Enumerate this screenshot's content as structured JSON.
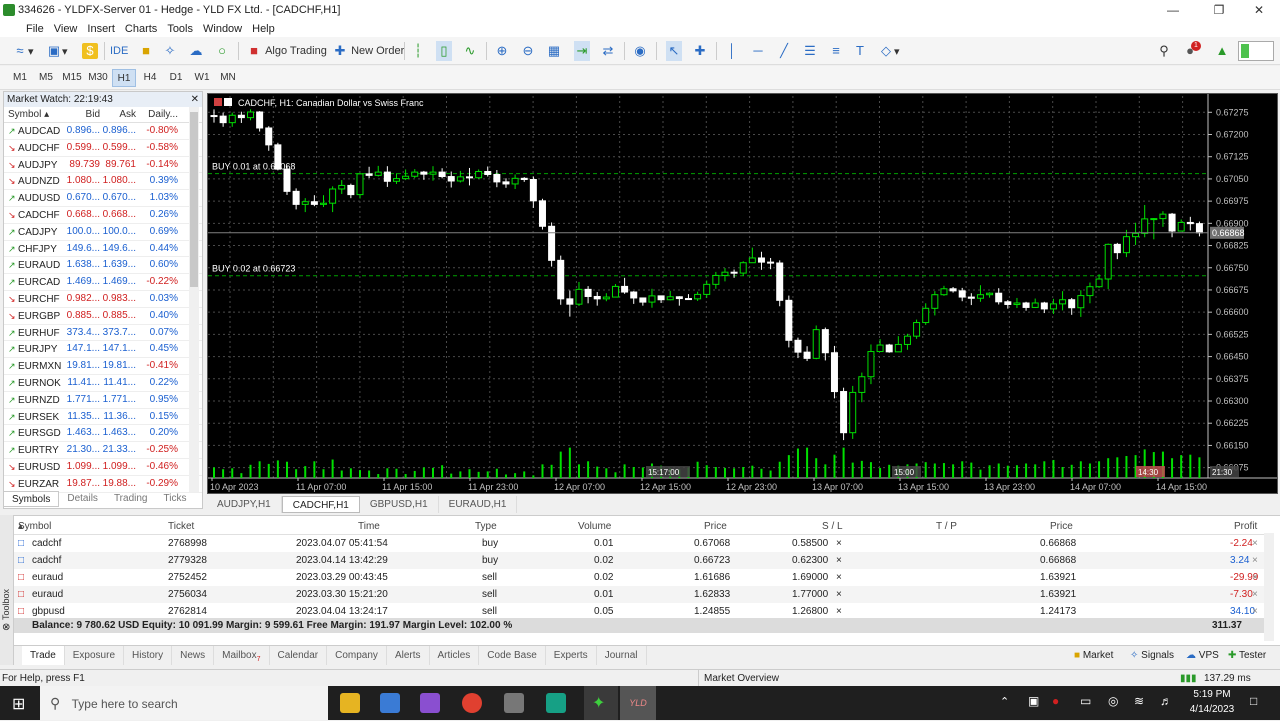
{
  "window": {
    "title": "334626 - YLDFX-Server 01 - Hedge - YLD FX Ltd. - [CADCHF,H1]"
  },
  "menu": [
    "File",
    "View",
    "Insert",
    "Charts",
    "Tools",
    "Window",
    "Help"
  ],
  "toolbar": {
    "ide": "IDE",
    "algo": "Algo Trading",
    "new_order": "New Order"
  },
  "timeframes": [
    {
      "label": "M1"
    },
    {
      "label": "M5"
    },
    {
      "label": "M15"
    },
    {
      "label": "M30"
    },
    {
      "label": "H1",
      "active": true
    },
    {
      "label": "H4"
    },
    {
      "label": "D1"
    },
    {
      "label": "W1"
    },
    {
      "label": "MN"
    }
  ],
  "market_watch": {
    "title": "Market Watch: 22:19:43",
    "columns": [
      "Symbol",
      "Bid",
      "Ask",
      "Daily..."
    ],
    "rows": [
      {
        "symbol": "AUDCAD",
        "bid": "0.896...",
        "ask": "0.896...",
        "chg": "-0.80%",
        "dir": "up"
      },
      {
        "symbol": "AUDCHF",
        "bid": "0.599...",
        "ask": "0.599...",
        "chg": "-0.58%",
        "dir": "dn"
      },
      {
        "symbol": "AUDJPY",
        "bid": "89.739",
        "ask": "89.761",
        "chg": "-0.14%",
        "dir": "dn"
      },
      {
        "symbol": "AUDNZD",
        "bid": "1.080...",
        "ask": "1.080...",
        "chg": "0.39%",
        "dir": "dn"
      },
      {
        "symbol": "AUDUSD",
        "bid": "0.670...",
        "ask": "0.670...",
        "chg": "1.03%",
        "dir": "up"
      },
      {
        "symbol": "CADCHF",
        "bid": "0.668...",
        "ask": "0.668...",
        "chg": "0.26%",
        "dir": "dn"
      },
      {
        "symbol": "CADJPY",
        "bid": "100.0...",
        "ask": "100.0...",
        "chg": "0.69%",
        "dir": "up"
      },
      {
        "symbol": "CHFJPY",
        "bid": "149.6...",
        "ask": "149.6...",
        "chg": "0.44%",
        "dir": "up"
      },
      {
        "symbol": "EURAUD",
        "bid": "1.638...",
        "ask": "1.639...",
        "chg": "0.60%",
        "dir": "up"
      },
      {
        "symbol": "EURCAD",
        "bid": "1.469...",
        "ask": "1.469...",
        "chg": "-0.22%",
        "dir": "up"
      },
      {
        "symbol": "EURCHF",
        "bid": "0.982...",
        "ask": "0.983...",
        "chg": "0.03%",
        "dir": "dn"
      },
      {
        "symbol": "EURGBP",
        "bid": "0.885...",
        "ask": "0.885...",
        "chg": "0.40%",
        "dir": "dn"
      },
      {
        "symbol": "EURHUF",
        "bid": "373.4...",
        "ask": "373.7...",
        "chg": "0.07%",
        "dir": "up"
      },
      {
        "symbol": "EURJPY",
        "bid": "147.1...",
        "ask": "147.1...",
        "chg": "0.45%",
        "dir": "up"
      },
      {
        "symbol": "EURMXN",
        "bid": "19.81...",
        "ask": "19.81...",
        "chg": "-0.41%",
        "dir": "up"
      },
      {
        "symbol": "EURNOK",
        "bid": "11.41...",
        "ask": "11.41...",
        "chg": "0.22%",
        "dir": "up"
      },
      {
        "symbol": "EURNZD",
        "bid": "1.771...",
        "ask": "1.771...",
        "chg": "0.95%",
        "dir": "up"
      },
      {
        "symbol": "EURSEK",
        "bid": "11.35...",
        "ask": "11.36...",
        "chg": "0.15%",
        "dir": "up"
      },
      {
        "symbol": "EURSGD",
        "bid": "1.463...",
        "ask": "1.463...",
        "chg": "0.20%",
        "dir": "up"
      },
      {
        "symbol": "EURTRY",
        "bid": "21.30...",
        "ask": "21.33...",
        "chg": "-0.25%",
        "dir": "up"
      },
      {
        "symbol": "EURUSD",
        "bid": "1.099...",
        "ask": "1.099...",
        "chg": "-0.46%",
        "dir": "dn"
      },
      {
        "symbol": "EURZAR",
        "bid": "19.87...",
        "ask": "19.88...",
        "chg": "-0.29%",
        "dir": "dn"
      }
    ],
    "tabs": [
      "Symbols",
      "Details",
      "Trading",
      "Ticks"
    ]
  },
  "chart": {
    "header": "CADCHF, H1:  Canadian Dollar vs Swiss Franc",
    "price_labels": [
      "0.67275",
      "0.67200",
      "0.67125",
      "0.67050",
      "0.66975",
      "0.66900",
      "0.66825",
      "0.66750",
      "0.66675",
      "0.66600",
      "0.66525",
      "0.66450",
      "0.66375",
      "0.66300",
      "0.66225",
      "0.66150",
      "0.66075"
    ],
    "current_price": "0.66868",
    "time_labels": [
      "10 Apr 2023",
      "11 Apr 07:00",
      "11 Apr 15:00",
      "11 Apr 23:00",
      "12 Apr 07:00",
      "12 Apr 15:00",
      "12 Apr 23:00",
      "13 Apr 07:00",
      "13 Apr 15:00",
      "13 Apr 23:00",
      "14 Apr 07:00",
      "14 Apr 15:00"
    ],
    "markers": [
      "15:17:00",
      "15:00",
      "14:30",
      "21:30"
    ],
    "orders": [
      {
        "label": "BUY 0.01 at 0.67068",
        "price": 0.67068
      },
      {
        "label": "BUY 0.02 at 0.66723",
        "price": 0.66723
      }
    ],
    "tabs": [
      "AUDJPY,H1",
      "CADCHF,H1",
      "GBPUSD,H1",
      "EURAUD,H1"
    ],
    "active_tab": "CADCHF,H1"
  },
  "trade": {
    "columns": [
      "Symbol",
      "Ticket",
      "Time",
      "Type",
      "Volume",
      "Price",
      "S / L",
      "T / P",
      "Price",
      "Profit"
    ],
    "rows": [
      {
        "symbol": "cadchf",
        "ticket": "2768998",
        "time": "2023.04.07 05:41:54",
        "type": "buy",
        "volume": "0.01",
        "price": "0.67068",
        "sl": "0.58500",
        "cur": "0.66868",
        "profit": "-2.24",
        "neg": true
      },
      {
        "symbol": "cadchf",
        "ticket": "2779328",
        "time": "2023.04.14 13:42:29",
        "type": "buy",
        "volume": "0.02",
        "price": "0.66723",
        "sl": "0.62300",
        "cur": "0.66868",
        "profit": "3.24",
        "neg": false
      },
      {
        "symbol": "euraud",
        "ticket": "2752452",
        "time": "2023.03.29 00:43:45",
        "type": "sell",
        "volume": "0.02",
        "price": "1.61686",
        "sl": "1.69000",
        "cur": "1.63921",
        "profit": "-29.99",
        "neg": true
      },
      {
        "symbol": "euraud",
        "ticket": "2756034",
        "time": "2023.03.30 15:21:20",
        "type": "sell",
        "volume": "0.01",
        "price": "1.62833",
        "sl": "1.77000",
        "cur": "1.63921",
        "profit": "-7.30",
        "neg": true
      },
      {
        "symbol": "gbpusd",
        "ticket": "2762814",
        "time": "2023.04.04 13:24:17",
        "type": "sell",
        "volume": "0.05",
        "price": "1.24855",
        "sl": "1.26800",
        "cur": "1.24173",
        "profit": "34.10",
        "neg": false
      }
    ],
    "balance_line": "Balance: 9 780.62 USD  Equity: 10 091.99  Margin: 9 599.61  Free Margin: 191.97  Margin Level: 102.00 %",
    "total_profit": "311.37",
    "tabs": [
      "Trade",
      "Exposure",
      "History",
      "News",
      "Mailbox",
      "Calendar",
      "Company",
      "Alerts",
      "Articles",
      "Code Base",
      "Experts",
      "Journal"
    ],
    "mailbox_count": "7",
    "side_label": "Toolbox",
    "right_links": [
      "Market",
      "Signals",
      "VPS",
      "Tester"
    ]
  },
  "status": {
    "help": "For Help, press F1",
    "overview": "Market Overview",
    "ping": "137.29 ms"
  },
  "taskbar": {
    "search": "Type here to search",
    "time": "5:19 PM",
    "date": "4/14/2023",
    "app_label": "YLD"
  },
  "colors": {
    "bull": "#00e000",
    "bear": "#ffffff",
    "order_line": "#00a000",
    "grid": "#4a4a4a",
    "axis": "#c0c0c0"
  },
  "chart_data": {
    "type": "candlestick",
    "symbol": "CADCHF",
    "timeframe": "H1",
    "ylim": [
      0.6604,
      0.6733
    ],
    "candles": [
      [
        0.67264,
        0.67262,
        0.67285,
        0.6724
      ],
      [
        0.67262,
        0.6724,
        0.67274,
        0.67226
      ],
      [
        0.6724,
        0.67265,
        0.67274,
        0.67226
      ],
      [
        0.67265,
        0.67257,
        0.67277,
        0.67239
      ],
      [
        0.67257,
        0.67276,
        0.67285,
        0.67248
      ],
      [
        0.67276,
        0.67222,
        0.67279,
        0.6721
      ],
      [
        0.67222,
        0.67165,
        0.67228,
        0.67145
      ],
      [
        0.67165,
        0.67083,
        0.67172,
        0.67079
      ],
      [
        0.67083,
        0.67008,
        0.67095,
        0.66996
      ],
      [
        0.67008,
        0.66964,
        0.67018,
        0.66947
      ],
      [
        0.66964,
        0.66973,
        0.66985,
        0.66938
      ],
      [
        0.66973,
        0.66964,
        0.66995,
        0.66958
      ],
      [
        0.66964,
        0.66968,
        0.66995,
        0.66955
      ],
      [
        0.66968,
        0.67016,
        0.67025,
        0.66938
      ],
      [
        0.67016,
        0.67028,
        0.67046,
        0.66999
      ],
      [
        0.67028,
        0.66997,
        0.67034,
        0.66985
      ],
      [
        0.66997,
        0.67067,
        0.6707,
        0.66984
      ],
      [
        0.67067,
        0.67062,
        0.67091,
        0.67053
      ],
      [
        0.67062,
        0.67073,
        0.67094,
        0.67058
      ],
      [
        0.67073,
        0.67042,
        0.67093,
        0.67023
      ],
      [
        0.67042,
        0.67051,
        0.67069,
        0.67033
      ],
      [
        0.67051,
        0.67059,
        0.67082,
        0.67046
      ],
      [
        0.67059,
        0.67073,
        0.67083,
        0.67053
      ],
      [
        0.67073,
        0.67066,
        0.67077,
        0.67047
      ],
      [
        0.67066,
        0.67073,
        0.67093,
        0.67044
      ],
      [
        0.67073,
        0.67058,
        0.67086,
        0.67052
      ],
      [
        0.67058,
        0.67043,
        0.67075,
        0.67021
      ],
      [
        0.67043,
        0.67057,
        0.67077,
        0.67038
      ],
      [
        0.67057,
        0.67054,
        0.67087,
        0.67028
      ],
      [
        0.67054,
        0.67075,
        0.67082,
        0.6705
      ],
      [
        0.67075,
        0.67065,
        0.67092,
        0.67058
      ],
      [
        0.67065,
        0.6704,
        0.6708,
        0.67022
      ],
      [
        0.6704,
        0.67033,
        0.67052,
        0.6702
      ],
      [
        0.67033,
        0.67052,
        0.67065,
        0.67016
      ],
      [
        0.67052,
        0.67048,
        0.67056,
        0.6704
      ],
      [
        0.67048,
        0.66976,
        0.67058,
        0.66952
      ],
      [
        0.66976,
        0.6689,
        0.66983,
        0.66879
      ],
      [
        0.6689,
        0.66775,
        0.66903,
        0.66754
      ],
      [
        0.66775,
        0.66645,
        0.66791,
        0.66625
      ],
      [
        0.66645,
        0.66627,
        0.66673,
        0.66585
      ],
      [
        0.66627,
        0.66677,
        0.66702,
        0.66621
      ],
      [
        0.66677,
        0.66653,
        0.66688,
        0.6663
      ],
      [
        0.66653,
        0.66645,
        0.66668,
        0.66622
      ],
      [
        0.66645,
        0.66651,
        0.66664,
        0.66637
      ],
      [
        0.66651,
        0.66687,
        0.66695,
        0.6665
      ],
      [
        0.66687,
        0.66668,
        0.66716,
        0.66662
      ],
      [
        0.66668,
        0.66648,
        0.66671,
        0.66628
      ],
      [
        0.66648,
        0.66634,
        0.66642,
        0.66622
      ],
      [
        0.66634,
        0.66655,
        0.66679,
        0.66615
      ],
      [
        0.66655,
        0.66642,
        0.66655,
        0.66631
      ],
      [
        0.66642,
        0.66652,
        0.66672,
        0.6664
      ],
      [
        0.66652,
        0.66646,
        0.66654,
        0.66622
      ],
      [
        0.66646,
        0.66645,
        0.66661,
        0.66643
      ],
      [
        0.66645,
        0.6666,
        0.66669,
        0.66638
      ],
      [
        0.6666,
        0.66694,
        0.66707,
        0.66648
      ],
      [
        0.66694,
        0.66724,
        0.66736,
        0.66679
      ],
      [
        0.66724,
        0.66735,
        0.66749,
        0.66704
      ],
      [
        0.66735,
        0.66732,
        0.66744,
        0.66716
      ],
      [
        0.66732,
        0.66767,
        0.66772,
        0.66722
      ],
      [
        0.66767,
        0.66783,
        0.66818,
        0.66766
      ],
      [
        0.66783,
        0.66769,
        0.66804,
        0.66743
      ],
      [
        0.66769,
        0.66766,
        0.66783,
        0.66745
      ],
      [
        0.66766,
        0.6664,
        0.66775,
        0.6662
      ],
      [
        0.6664,
        0.66505,
        0.66656,
        0.66481
      ],
      [
        0.66505,
        0.66465,
        0.66514,
        0.66445
      ],
      [
        0.66465,
        0.66444,
        0.66485,
        0.66435
      ],
      [
        0.66444,
        0.66541,
        0.66555,
        0.66441
      ],
      [
        0.66541,
        0.66463,
        0.66548,
        0.66437
      ],
      [
        0.66463,
        0.66332,
        0.66486,
        0.66309
      ],
      [
        0.66332,
        0.66193,
        0.66345,
        0.66168
      ],
      [
        0.66193,
        0.66329,
        0.66351,
        0.66172
      ],
      [
        0.66329,
        0.66382,
        0.66396,
        0.66296
      ],
      [
        0.66382,
        0.66467,
        0.66491,
        0.66357
      ],
      [
        0.66467,
        0.66489,
        0.66509,
        0.66474
      ],
      [
        0.66489,
        0.66466,
        0.66493,
        0.66463
      ],
      [
        0.66466,
        0.66491,
        0.66519,
        0.66466
      ],
      [
        0.66491,
        0.66519,
        0.66527,
        0.66473
      ],
      [
        0.66519,
        0.66565,
        0.66575,
        0.6651
      ],
      [
        0.66565,
        0.66613,
        0.6663,
        0.66557
      ],
      [
        0.66613,
        0.66659,
        0.66671,
        0.66589
      ],
      [
        0.66659,
        0.66679,
        0.66689,
        0.66655
      ],
      [
        0.66679,
        0.66672,
        0.66685,
        0.66666
      ],
      [
        0.66672,
        0.66651,
        0.66682,
        0.66637
      ],
      [
        0.66651,
        0.66647,
        0.66664,
        0.66624
      ],
      [
        0.66647,
        0.66659,
        0.66691,
        0.66635
      ],
      [
        0.66659,
        0.66664,
        0.66667,
        0.66649
      ],
      [
        0.66664,
        0.66635,
        0.66681,
        0.66626
      ],
      [
        0.66635,
        0.66626,
        0.66641,
        0.66612
      ],
      [
        0.66626,
        0.66631,
        0.66648,
        0.66614
      ],
      [
        0.66631,
        0.66616,
        0.66635,
        0.66605
      ],
      [
        0.66616,
        0.66631,
        0.66646,
        0.66614
      ],
      [
        0.66631,
        0.66611,
        0.66635,
        0.66597
      ],
      [
        0.66611,
        0.66628,
        0.66645,
        0.66594
      ],
      [
        0.66628,
        0.66642,
        0.66671,
        0.66606
      ],
      [
        0.66642,
        0.66615,
        0.66648,
        0.66591
      ],
      [
        0.66615,
        0.66656,
        0.66674,
        0.66584
      ],
      [
        0.66656,
        0.66686,
        0.667,
        0.6663
      ],
      [
        0.66686,
        0.66712,
        0.66728,
        0.66682
      ],
      [
        0.66712,
        0.66829,
        0.66832,
        0.66678
      ],
      [
        0.66829,
        0.66801,
        0.66834,
        0.66779
      ],
      [
        0.66801,
        0.66855,
        0.66878,
        0.66786
      ],
      [
        0.66855,
        0.66866,
        0.66902,
        0.66827
      ],
      [
        0.66866,
        0.66915,
        0.66962,
        0.66853
      ],
      [
        0.66915,
        0.66916,
        0.66918,
        0.66846
      ],
      [
        0.66916,
        0.66931,
        0.66941,
        0.66888
      ],
      [
        0.66931,
        0.66874,
        0.66935,
        0.66853
      ],
      [
        0.66874,
        0.66903,
        0.66913,
        0.66872
      ],
      [
        0.66903,
        0.66899,
        0.66922,
        0.66876
      ],
      [
        0.66899,
        0.66868,
        0.66906,
        0.66856
      ]
    ],
    "volume": [
      0.24,
      0.2,
      0.22,
      0.11,
      0.3,
      0.38,
      0.32,
      0.4,
      0.37,
      0.2,
      0.27,
      0.38,
      0.2,
      0.42,
      0.17,
      0.22,
      0.18,
      0.17,
      0.09,
      0.22,
      0.21,
      0.09,
      0.16,
      0.24,
      0.23,
      0.29,
      0.1,
      0.15,
      0.2,
      0.14,
      0.15,
      0.21,
      0.08,
      0.11,
      0.15,
      0.06,
      0.31,
      0.3,
      0.6,
      0.69,
      0.31,
      0.38,
      0.26,
      0.22,
      0.13,
      0.31,
      0.25,
      0.24,
      0.33,
      0.28,
      0.22,
      0.2,
      0.24,
      0.37,
      0.29,
      0.25,
      0.23,
      0.22,
      0.25,
      0.28,
      0.21,
      0.17,
      0.37,
      0.52,
      0.67,
      0.69,
      0.45,
      0.31,
      0.53,
      0.69,
      0.35,
      0.39,
      0.36,
      0.23,
      0.3,
      0.28,
      0.31,
      0.33,
      0.36,
      0.33,
      0.34,
      0.31,
      0.38,
      0.35,
      0.19,
      0.29,
      0.33,
      0.28,
      0.29,
      0.33,
      0.31,
      0.38,
      0.41,
      0.25,
      0.3,
      0.38,
      0.33,
      0.38,
      0.45,
      0.47,
      0.5,
      0.52,
      0.65,
      0.59,
      0.6,
      0.45,
      0.52,
      0.53,
      0.47,
      0.5
    ]
  }
}
